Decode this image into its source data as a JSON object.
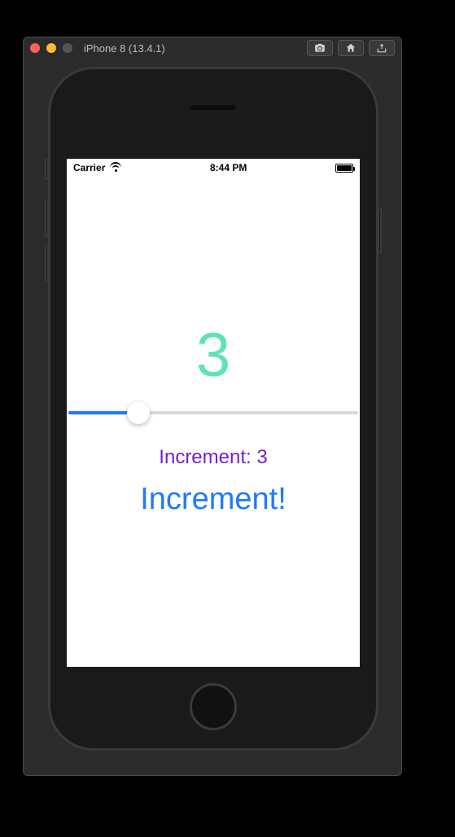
{
  "window": {
    "title": "iPhone 8 (13.4.1)",
    "buttons": {
      "screenshot": "screenshot-icon",
      "home": "home-icon",
      "rotate": "rotate-icon"
    }
  },
  "statusbar": {
    "carrier": "Carrier",
    "time": "8:44 PM"
  },
  "app": {
    "counter_value": "3",
    "slider": {
      "min": 0,
      "max": 100,
      "value": 22
    },
    "increment_label_prefix": "Increment: ",
    "increment_label_value": "3",
    "increment_button": "Increment!"
  },
  "colors": {
    "counter": "#5fe3b3",
    "increment_label": "#7a1bd1",
    "accent": "#1f7aff"
  }
}
